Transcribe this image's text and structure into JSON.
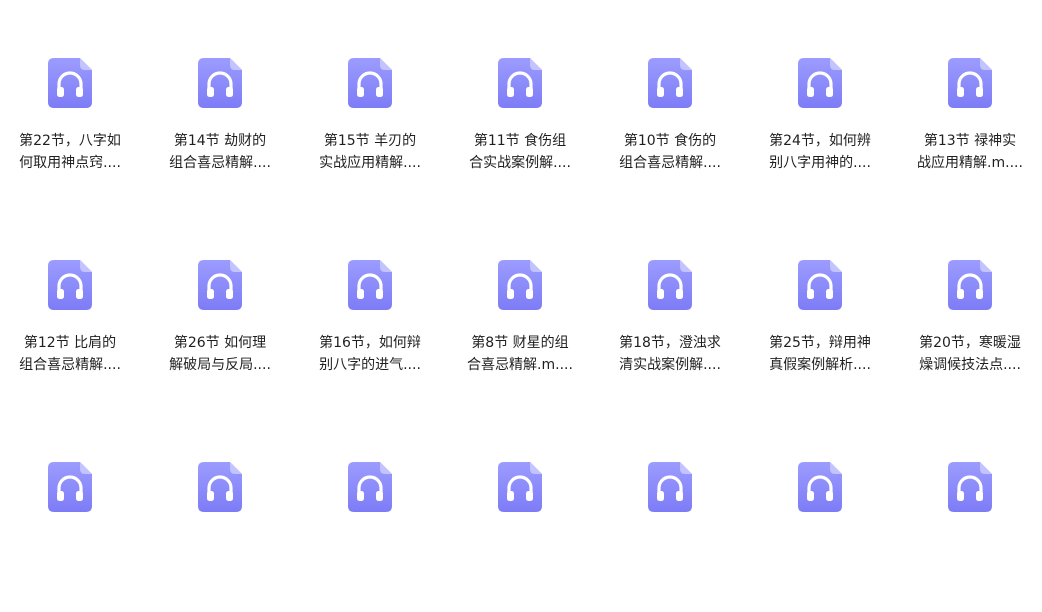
{
  "colors": {
    "icon_top": "#9c9cff",
    "icon_bottom": "#7d7cf6",
    "icon_fold": "#c3c3ff",
    "glyph": "#ffffff",
    "text": "#1f1f1f"
  },
  "icon": "headphones-audio-file-icon",
  "files": [
    {
      "line1": "第22节，八字如",
      "line2": "何取用神点窍...."
    },
    {
      "line1": "第14节 劫财的",
      "line2": "组合喜忌精解...."
    },
    {
      "line1": "第15节 羊刃的",
      "line2": "实战应用精解...."
    },
    {
      "line1": "第11节 食伤组",
      "line2": "合实战案例解...."
    },
    {
      "line1": "第10节 食伤的",
      "line2": "组合喜忌精解...."
    },
    {
      "line1": "第24节，如何辨",
      "line2": "别八字用神的...."
    },
    {
      "line1": "第13节 禄神实",
      "line2": "战应用精解.m...."
    },
    {
      "line1": "第12节 比肩的",
      "line2": "组合喜忌精解...."
    },
    {
      "line1": "第26节 如何理",
      "line2": "解破局与反局...."
    },
    {
      "line1": "第16节，如何辩",
      "line2": "别八字的进气...."
    },
    {
      "line1": "第8节 财星的组",
      "line2": "合喜忌精解.m...."
    },
    {
      "line1": "第18节，澄浊求",
      "line2": "清实战案例解...."
    },
    {
      "line1": "第25节，辩用神",
      "line2": "真假案例解析...."
    },
    {
      "line1": "第20节，寒暖湿",
      "line2": "燥调候技法点...."
    },
    {
      "line1": "",
      "line2": ""
    },
    {
      "line1": "",
      "line2": ""
    },
    {
      "line1": "",
      "line2": ""
    },
    {
      "line1": "",
      "line2": ""
    },
    {
      "line1": "",
      "line2": ""
    },
    {
      "line1": "",
      "line2": ""
    },
    {
      "line1": "",
      "line2": ""
    }
  ]
}
